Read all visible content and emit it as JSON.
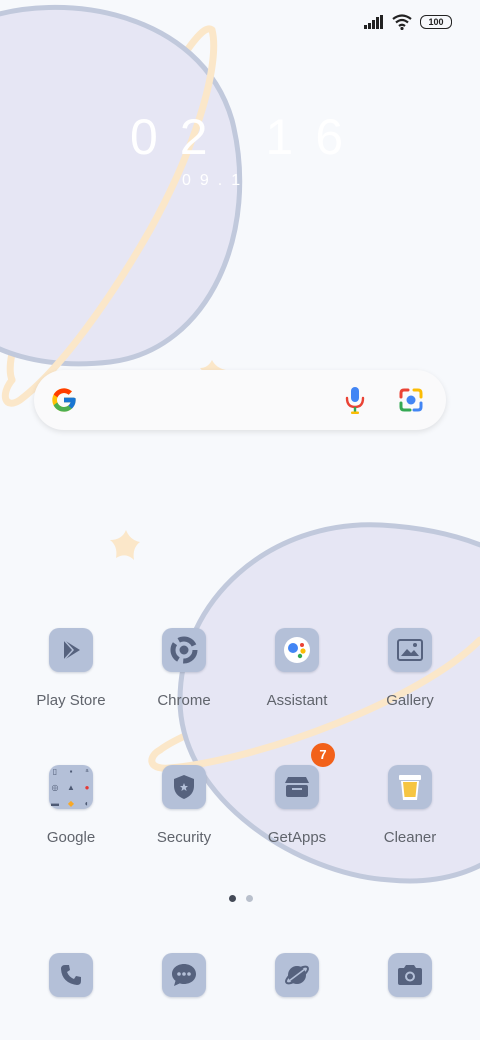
{
  "status_bar": {
    "signal_icon": "cellular-signal-icon",
    "wifi_icon": "wifi-icon",
    "battery": "100"
  },
  "clock": {
    "time": "02 16",
    "date": "09.1"
  },
  "search": {
    "logo_icon": "google-g-icon",
    "voice_icon": "microphone-icon",
    "lens_icon": "camera-lens-icon"
  },
  "apps": [
    {
      "label": "Play Store",
      "icon": "play-store-icon"
    },
    {
      "label": "Chrome",
      "icon": "chrome-icon"
    },
    {
      "label": "Assistant",
      "icon": "assistant-icon"
    },
    {
      "label": "Gallery",
      "icon": "gallery-icon"
    },
    {
      "label": "Google",
      "icon": "google-folder-icon"
    },
    {
      "label": "Security",
      "icon": "shield-icon"
    },
    {
      "label": "GetApps",
      "icon": "store-icon",
      "badge": "7"
    },
    {
      "label": "Cleaner",
      "icon": "trash-bin-icon"
    }
  ],
  "page_indicator": {
    "pages": 2,
    "current": 1
  },
  "dock": [
    {
      "icon": "phone-icon"
    },
    {
      "icon": "messages-icon"
    },
    {
      "icon": "browser-planet-icon"
    },
    {
      "icon": "camera-icon"
    }
  ],
  "colors": {
    "background": "#f7f9fc",
    "planet_fill": "#e6e6f4",
    "planet_stroke": "#c1c9dc",
    "ring": "#fbe7c9",
    "icon_tile": "#b4c0d8",
    "icon_glyph": "#56627e",
    "badge": "#f2611a"
  }
}
